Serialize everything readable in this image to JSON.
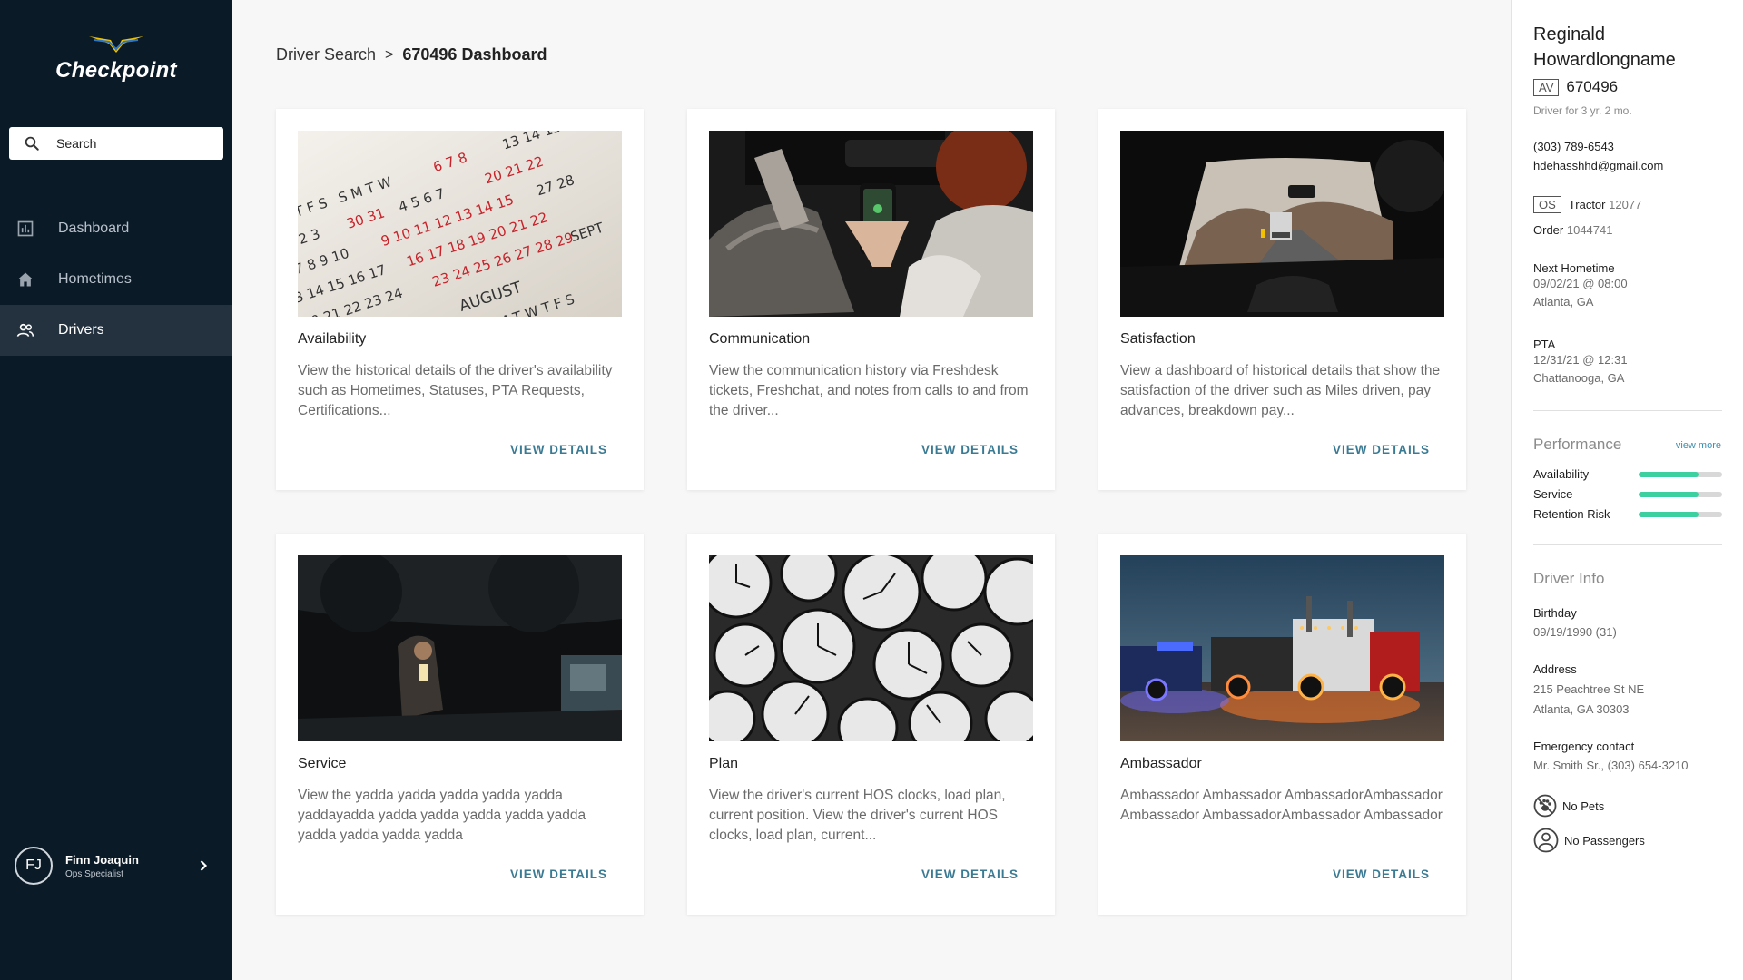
{
  "app": {
    "name": "Checkpoint",
    "search_placeholder": "Search"
  },
  "nav": [
    {
      "label": "Dashboard",
      "icon": "bar-chart-icon",
      "active": false
    },
    {
      "label": "Hometimes",
      "icon": "home-icon",
      "active": false
    },
    {
      "label": "Drivers",
      "icon": "people-icon",
      "active": true
    }
  ],
  "user": {
    "initials": "FJ",
    "name": "Finn Joaquin",
    "role": "Ops Specialist"
  },
  "breadcrumb": {
    "parent": "Driver Search",
    "separator": ">",
    "current": "670496 Dashboard"
  },
  "cards": [
    {
      "title": "Availability",
      "description": "View the historical details of the driver's availability such as Hometimes, Statuses, PTA Requests, Certifications...",
      "action": "VIEW DETAILS",
      "image": "calendar-photo"
    },
    {
      "title": "Communication",
      "description": "View the communication history via Freshdesk tickets, Freshchat, and notes from calls to and from the driver...",
      "action": "VIEW DETAILS",
      "image": "phone-in-truck-photo"
    },
    {
      "title": "Satisfaction",
      "description": "View a dashboard of historical details that show the satisfaction of the driver such as Miles driven, pay advances, breakdown pay...",
      "action": "VIEW DETAILS",
      "image": "road-through-windshield-photo"
    },
    {
      "title": "Service",
      "description": "View the yadda yadda yadda yadda yadda yaddayadda yadda yadda yadda yadda yadda yadda yadda yadda yadda",
      "action": "VIEW DETAILS",
      "image": "mechanic-under-truck-photo"
    },
    {
      "title": "Plan",
      "description": "View the driver's current HOS clocks, load plan, current position. View the driver's current HOS clocks, load plan, current...",
      "action": "VIEW DETAILS",
      "image": "clocks-photo"
    },
    {
      "title": "Ambassador",
      "description": "Ambassador Ambassador AmbassadorAmbassador Ambassador AmbassadorAmbassador Ambassador",
      "action": "VIEW DETAILS",
      "image": "lit-trucks-at-night-photo"
    }
  ],
  "driver": {
    "name": "Reginald Howardlongname",
    "tag": "AV",
    "id": "670496",
    "tenure": "Driver for 3 yr. 2 mo.",
    "phone": "(303) 789-6543",
    "email": "hdehasshhd@gmail.com",
    "tractor_tag": "OS",
    "tractor_label": "Tractor",
    "tractor_value": "12077",
    "order_label": "Order",
    "order_value": "1044741",
    "next_hometime_label": "Next Hometime",
    "next_hometime_date": "09/02/21 @ 08:00",
    "next_hometime_location": "Atlanta, GA",
    "pta_label": "PTA",
    "pta_date": "12/31/21 @ 12:31",
    "pta_location": "Chattanooga, GA"
  },
  "performance": {
    "title": "Performance",
    "view_more": "view more",
    "metrics": [
      {
        "label": "Availability",
        "value": 0.72
      },
      {
        "label": "Service",
        "value": 0.72
      },
      {
        "label": "Retention Risk",
        "value": 0.72
      }
    ]
  },
  "driver_info": {
    "title": "Driver Info",
    "birthday_label": "Birthday",
    "birthday_value": "09/19/1990 (31)",
    "address_label": "Address",
    "address_line1": "215 Peachtree St NE",
    "address_line2": "Atlanta, GA 30303",
    "emergency_label": "Emergency contact",
    "emergency_value": "Mr. Smith Sr., (303) 654-3210",
    "pets": "No Pets",
    "passengers": "No Passengers"
  },
  "colors": {
    "sidebar": "#0b1a27",
    "sidebar_active": "#24323f",
    "accent": "#3b7a93",
    "performance_bar": "#3ccfa0",
    "logo_gold": "#f2c200"
  }
}
